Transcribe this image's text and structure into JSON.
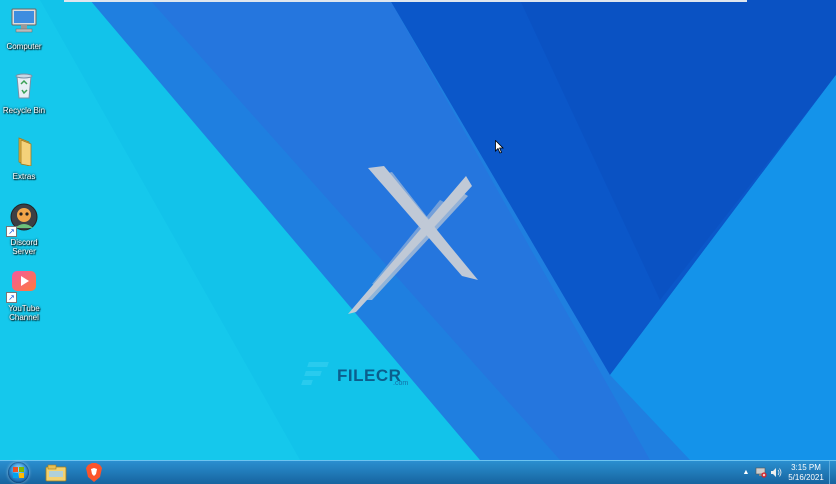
{
  "desktop": {
    "icons": [
      {
        "label": "Computer"
      },
      {
        "label": "Recycle Bin"
      },
      {
        "label": "Extras"
      },
      {
        "label": "Discord\nServer"
      },
      {
        "label": "YouTube\nChannel"
      }
    ],
    "watermark": {
      "brand": "FILECR",
      "domain": ".com"
    }
  },
  "taskbar": {
    "pinned": [
      {
        "icon": "windows-start-orb-icon"
      },
      {
        "icon": "file-explorer-icon"
      },
      {
        "icon": "brave-browser-icon"
      }
    ],
    "tray": {
      "icons": [
        "show-hidden-icons-arrow",
        "network-error-icon",
        "speaker-icon"
      ],
      "time": "3:15 PM",
      "date": "5/16/2021"
    }
  },
  "colors": {
    "wallpaper_cyan": "#12c3ea",
    "wallpaper_blue": "#1f6fd8",
    "wallpaper_dark": "#0b57c9",
    "taskbar": "#1e79bd"
  }
}
